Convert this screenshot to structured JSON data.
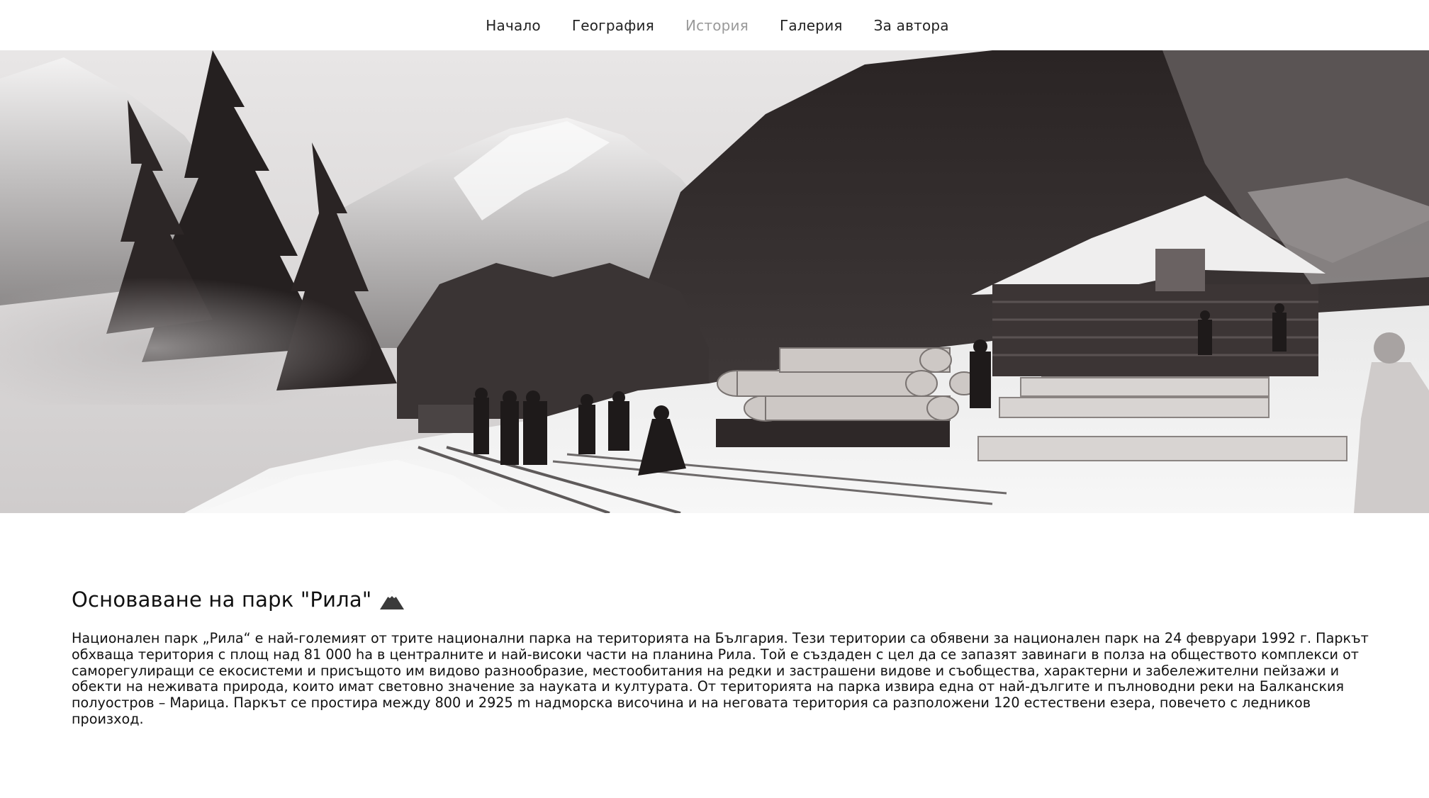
{
  "nav": {
    "items": [
      {
        "label": "Начало"
      },
      {
        "label": "География"
      },
      {
        "label": "История"
      },
      {
        "label": "Галерия"
      },
      {
        "label": "За автора"
      }
    ],
    "active_index": 2
  },
  "hero": {
    "image_semantic": "historic-photo-rila-logging-railway"
  },
  "article": {
    "title": "Основаване на парк \"Рила\"",
    "title_icon": "mountain-icon",
    "body": "Национален парк „Рила“ е най-големият от трите национални парка на територията на България. Тези територии са обявени за национален парк на 24 февруари 1992 г. Паркът обхваща територия с площ над 81 000 ha в централните и най-високи части на планина Рила. Той е създаден с цел да се запазят завинаги в полза на обществото комплекси от саморегулиращи се екосистеми и присъщото им видово разнообразие, местообитания на редки и застрашени видове и съобщества, характерни и забележителни пейзажи и обекти на неживата природа, които имат световно значение за науката и културата. От територията на парка извира една от най-дългите и пълноводни реки на Балканския полуостров – Марица. Паркът се простира между 800 и 2925 m надморска височина и на неговата територия са разположени 120 естествени езера, повечето с ледников произход."
  },
  "colors": {
    "nav_text": "#222222",
    "nav_active": "#9a9a9a",
    "text": "#111111",
    "background": "#ffffff"
  }
}
